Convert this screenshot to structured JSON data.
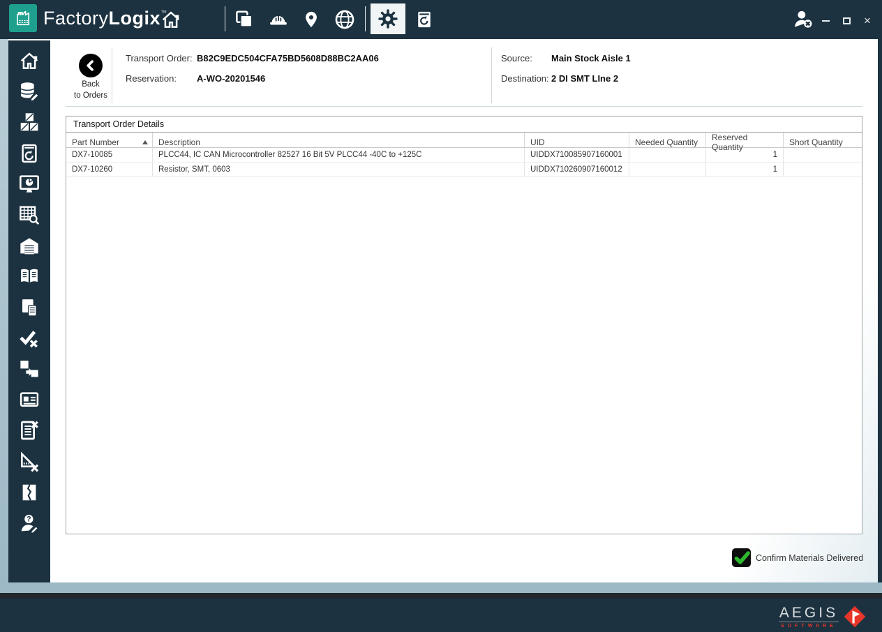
{
  "app": {
    "brand": {
      "light": "Factory",
      "bold": "Logix",
      "tm": "™"
    },
    "window_controls": {
      "close_glyph": "×"
    },
    "topbar_icons": [
      "factory-logo-icon",
      "home-icon",
      "layers-icon",
      "hardhat-icon",
      "location-pin-icon",
      "globe-icon",
      "gear-icon",
      "device-sync-icon",
      "user-logout-icon",
      "minimize-icon",
      "maximize-icon",
      "close-icon"
    ],
    "selected_tool": "gear"
  },
  "sidebar": {
    "icons": [
      "home-icon",
      "database-edit-icon",
      "inventory-boxes-icon",
      "device-history-icon",
      "dashboard-monitor-icon",
      "table-query-icon",
      "warehouse-icon",
      "book-icon",
      "documents-icon",
      "verify-check-icon",
      "transfer-boxes-icon",
      "id-card-icon",
      "cancel-list-icon",
      "measure-cancel-icon",
      "split-page-icon",
      "support-person-icon"
    ]
  },
  "header": {
    "back": {
      "line1": "Back",
      "line2": "to Orders"
    },
    "fields": [
      {
        "label": "Transport Order:",
        "value": "B82C9EDC504CFA75BD5608D88BC2AA06"
      },
      {
        "label": "Reservation:",
        "value": "A-WO-20201546"
      },
      {
        "label": "Source:",
        "value": "Main Stock Aisle 1"
      },
      {
        "label": "Destination:",
        "value": "2 DI SMT LIne 2"
      }
    ]
  },
  "table": {
    "title": "Transport Order Details",
    "sort": {
      "column": "Part Number",
      "direction": "ascending"
    },
    "columns": [
      "Part Number",
      "Description",
      "UID",
      "Needed Quantity",
      "Reserved Quantity",
      "Short Quantity"
    ],
    "rows": [
      {
        "part_number": "DX7-10085",
        "description": "PLCC44, IC CAN Microcontroller 82527 16 Bit 5V PLCC44 -40C to +125C",
        "uid": "UIDDX710085907160001",
        "needed_quantity": "",
        "reserved_quantity": "1",
        "short_quantity": ""
      },
      {
        "part_number": "DX7-10260",
        "description": "Resistor, SMT, 0603",
        "uid": "UIDDX710260907160012",
        "needed_quantity": "",
        "reserved_quantity": "1",
        "short_quantity": ""
      }
    ]
  },
  "confirm": {
    "label": "Confirm Materials Delivered",
    "checked": true
  },
  "footer": {
    "brand_name": "AEGIS",
    "brand_sub": "SOFTWARE"
  },
  "colors": {
    "navy": "#1c3240",
    "teal": "#1fa08e",
    "accent_red": "#e8352a",
    "check_green": "#2db82d",
    "selected_tab_bg": "#f2f5f6",
    "window_border_blue": "#9db9c6"
  }
}
